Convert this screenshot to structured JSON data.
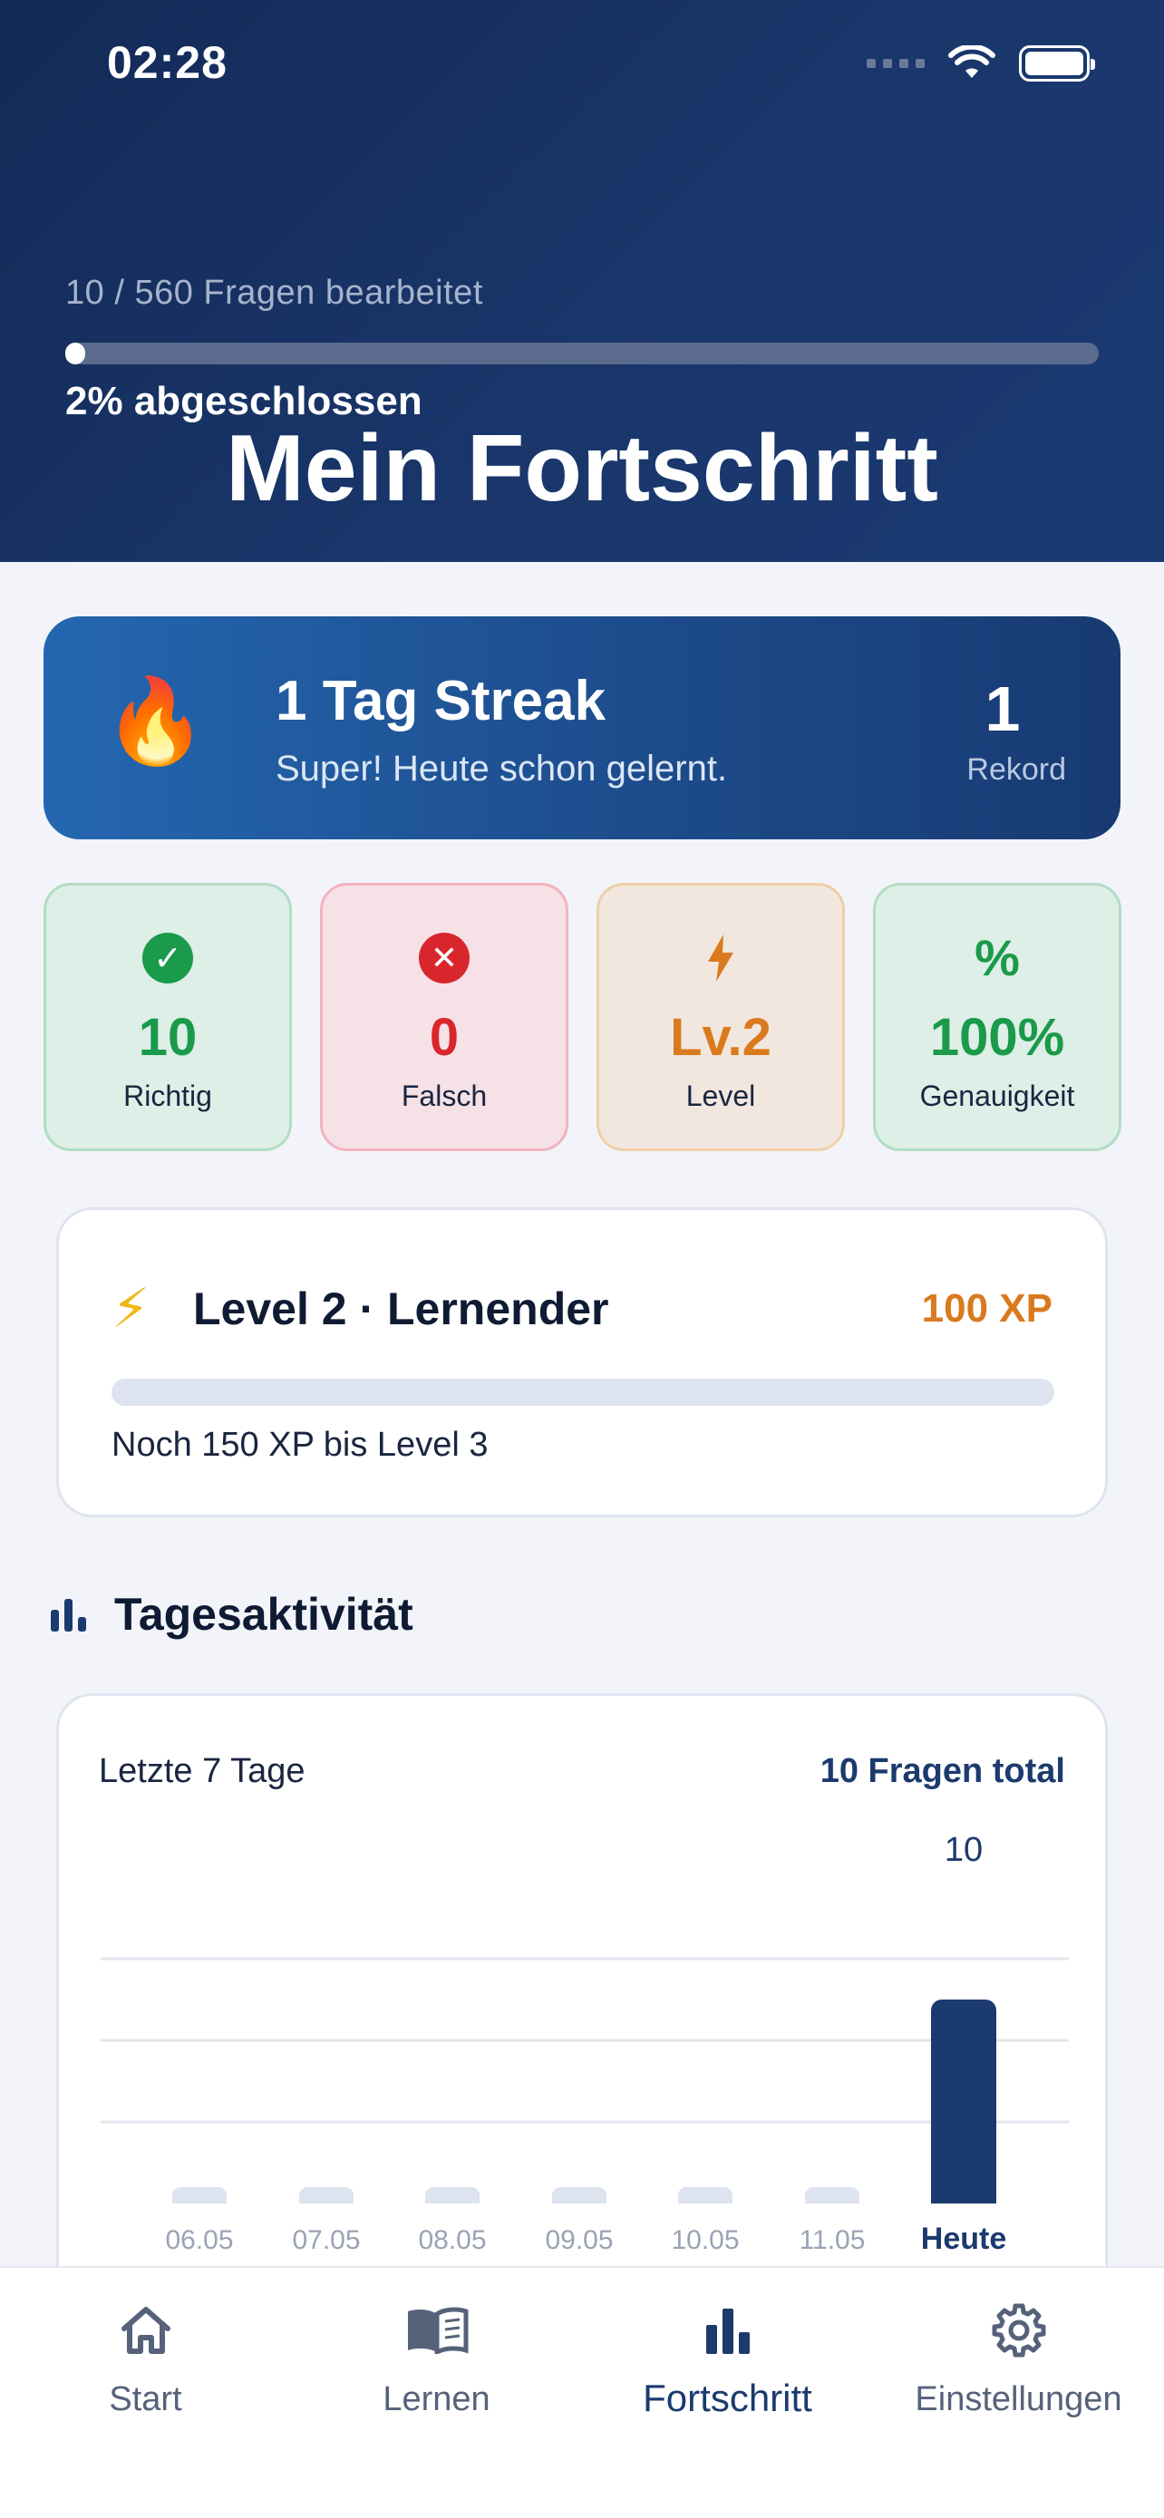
{
  "status": {
    "time": "02:28"
  },
  "header": {
    "progress_label": "10 / 560 Fragen bearbeitet",
    "progress_fraction": 0.018,
    "progress_percent_label": "2% abgeschlossen",
    "title": "Mein Fortschritt"
  },
  "streak": {
    "title": "1 Tag Streak",
    "subtitle": "Super! Heute schon gelernt.",
    "record_value": "1",
    "record_label": "Rekord",
    "icon": "flame-icon"
  },
  "stats": [
    {
      "value": "10",
      "label": "Richtig",
      "icon": "check-circle-icon",
      "color": "#1a9a4a"
    },
    {
      "value": "0",
      "label": "Falsch",
      "icon": "x-circle-icon",
      "color": "#d9262d"
    },
    {
      "value": "Lv.2",
      "label": "Level",
      "icon": "bolt-icon",
      "color": "#d97a1e"
    },
    {
      "value": "100%",
      "label": "Genauigkeit",
      "icon": "percent-icon",
      "color": "#1a9a4a"
    }
  ],
  "level": {
    "title": "Level 2 · Lernender",
    "xp": "100 XP",
    "progress_fraction": 0.0,
    "note": "Noch 150 XP bis Level 3"
  },
  "activity": {
    "section_title": "Tagesaktivität",
    "period_label": "Letzte 7 Tage",
    "total_label": "10 Fragen total"
  },
  "chart_data": {
    "type": "bar",
    "categories": [
      "06.05",
      "07.05",
      "08.05",
      "09.05",
      "10.05",
      "11.05",
      "Heute"
    ],
    "values": [
      0,
      0,
      0,
      0,
      0,
      0,
      10
    ],
    "value_labels": [
      "",
      "",
      "",
      "",
      "",
      "",
      "10"
    ],
    "highlight_index": 6,
    "colors": {
      "bar": "#1b3a6e",
      "empty": "#dde3ef"
    },
    "ylim": [
      0,
      12
    ],
    "grid": true
  },
  "tabs": [
    {
      "label": "Start",
      "icon": "home-icon",
      "active": false
    },
    {
      "label": "Lernen",
      "icon": "book-icon",
      "active": false
    },
    {
      "label": "Fortschritt",
      "icon": "bar-chart-icon",
      "active": true
    },
    {
      "label": "Einstellungen",
      "icon": "gear-icon",
      "active": false
    }
  ]
}
